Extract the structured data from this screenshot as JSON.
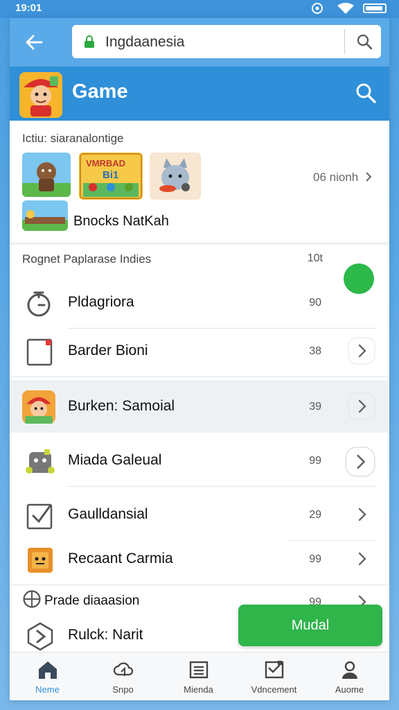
{
  "status": {
    "time": "19:01"
  },
  "url_bar": {
    "value": "Ingdaanesia"
  },
  "header": {
    "title": "Game"
  },
  "featured": {
    "label": "Ictiu: siaranalontige",
    "thumb2_text": "VMRBAD",
    "thumb2_sub": "Bi1",
    "more_label": "06 nionh",
    "name": "Bnocks NatKah"
  },
  "list": {
    "header": "Rognet Paplarase Indies",
    "header_count": "10t",
    "rows": [
      {
        "label": "Pldagriora",
        "count": "90",
        "icon": "clock-icon",
        "chevron": false
      },
      {
        "label": "Barder Bioni",
        "count": "38",
        "icon": "document-icon",
        "chevron": true
      },
      {
        "label": "Burken: Samoial",
        "count": "39",
        "icon": "game-avatar-icon",
        "chevron": true
      },
      {
        "label": "Miada Galeual",
        "count": "99",
        "icon": "cat-robot-icon",
        "chevron": true
      },
      {
        "label": "Gaulldansial",
        "count": "29",
        "icon": "checkbox-icon",
        "chevron": true
      },
      {
        "label": "Recaant Carmia",
        "count": "99",
        "icon": "box-face-icon",
        "chevron": true
      },
      {
        "label": "Prade diaaasion",
        "count": "99",
        "icon": "globe-icon",
        "chevron": true
      },
      {
        "label": "Rulck: Narit",
        "count": "",
        "icon": "play-hex-icon",
        "chevron": false
      }
    ]
  },
  "action_button": {
    "label": "Mudal"
  },
  "bottom_nav": [
    {
      "label": "Neme",
      "icon": "home-icon",
      "active": true
    },
    {
      "label": "Snpo",
      "icon": "cloud-icon",
      "active": false
    },
    {
      "label": "Mienda",
      "icon": "list-icon",
      "active": false
    },
    {
      "label": "Vdncement",
      "icon": "inbox-icon",
      "active": false
    },
    {
      "label": "Auome",
      "icon": "user-icon",
      "active": false
    }
  ],
  "colors": {
    "header_blue": "#2f8fd8",
    "accent_green": "#2fb54a"
  }
}
